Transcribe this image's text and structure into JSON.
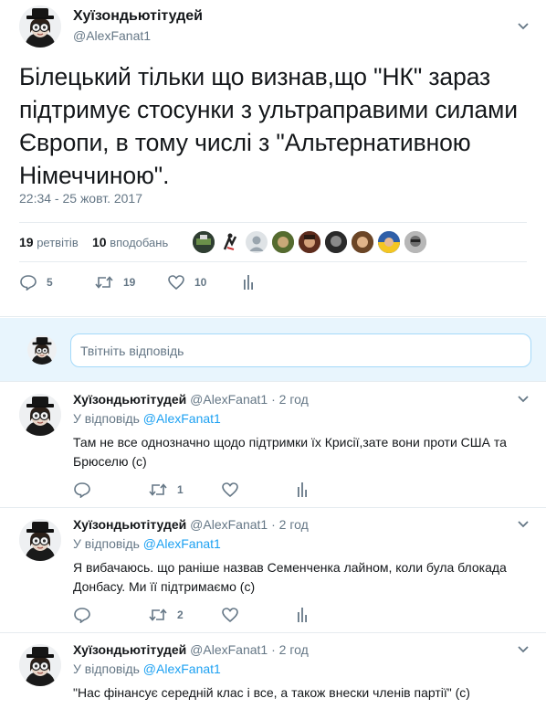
{
  "main_tweet": {
    "name": "Хуїзондьютітудей",
    "handle": "@AlexFanat1",
    "text": "Білецький тільки що визнав,що \"НК\" зараз підтримує стосунки з ультраправими силами Європи, в тому числі з \"Альтернативною Німеччиною\".",
    "timestamp": "22:34 - 25 жовт. 2017",
    "retweets_count": "19",
    "retweets_label": "ретвітів",
    "likes_count": "10",
    "likes_label": "вподобань",
    "actions": {
      "replies": "5",
      "retweets": "19",
      "likes": "10"
    }
  },
  "reply_box": {
    "placeholder": "Твітніть відповідь"
  },
  "replies": [
    {
      "name": "Хуїзондьютітудей",
      "handle": "@AlexFanat1",
      "dot": "·",
      "time": "2 год",
      "in_reply_prefix": "У відповідь",
      "in_reply_to": "@AlexFanat1",
      "text": "Там не все однозначно щодо підтримки їх Крисії,зате вони проти США та Брюселю (с)",
      "retweets": "1"
    },
    {
      "name": "Хуїзондьютітудей",
      "handle": "@AlexFanat1",
      "dot": "·",
      "time": "2 год",
      "in_reply_prefix": "У відповідь",
      "in_reply_to": "@AlexFanat1",
      "text": "Я вибачаюсь. що раніше назвав Семенченка лайном, коли була блокада Донбасу. Ми її підтримаємо (с)",
      "retweets": "2"
    },
    {
      "name": "Хуїзондьютітудей",
      "handle": "@AlexFanat1",
      "dot": "·",
      "time": "2 год",
      "in_reply_prefix": "У відповідь",
      "in_reply_to": "@AlexFanat1",
      "text": "\"Нас фінансує середній клас і все, а також внески членів партії\" (с)",
      "retweets": ""
    }
  ],
  "colors": {
    "accent": "#1da1f2",
    "muted": "#657786",
    "text": "#14171a",
    "reply_bg": "#e8f5fd"
  },
  "icons": [
    "caret-down-icon",
    "reply-icon",
    "retweet-icon",
    "like-icon",
    "analytics-icon"
  ]
}
